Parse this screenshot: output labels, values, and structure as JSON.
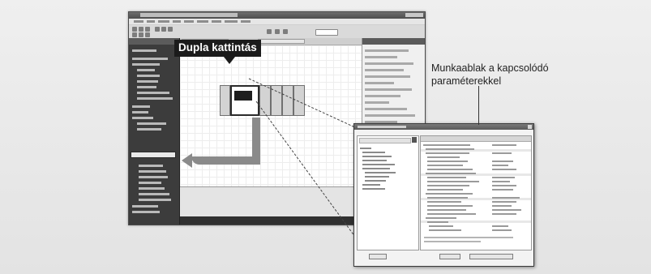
{
  "callouts": {
    "double_click": "Dupla kattintás",
    "work_window": "Munkaablak a kapcsolódó paraméterekkel"
  },
  "colors": {
    "callout_bg": "#1b1b1b",
    "connector": "#444444",
    "arrow": "#8a8a8a"
  },
  "icons": {
    "selected_module": "module-screen-icon",
    "flow_arrow": "left-arrow-icon"
  }
}
